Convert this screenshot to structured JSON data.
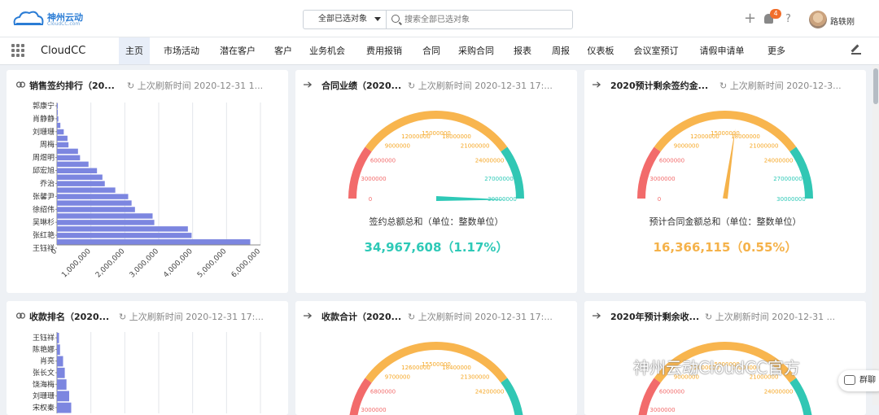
{
  "header": {
    "logo_text": "神州云动",
    "logo_sub": "CloudCC.com",
    "scope_label": "全部已选对象",
    "search_placeholder": "搜索全部已选对象",
    "notification_count": "4",
    "help": "?",
    "username": "路轶刚",
    "plus": "+"
  },
  "nav": {
    "app_name": "CloudCC",
    "tabs": [
      "主页",
      "市场活动",
      "潜在客户",
      "客户",
      "业务机会",
      "费用报销",
      "合同",
      "采购合同",
      "报表",
      "周报",
      "仪表板",
      "会议室预订",
      "请假申请单",
      "更多"
    ],
    "active": "主页"
  },
  "cards": {
    "c1": {
      "title": "销售签约排行（20...",
      "refresh": "上次刷新时间 2020-12-31 1..."
    },
    "c2": {
      "title": "合同业绩（2020...",
      "refresh": "上次刷新时间 2020-12-31 17:...",
      "label": "签约总额总和（单位：整数单位）",
      "value": "34,967,608（1.17%）",
      "value_color": "#2ec9b7"
    },
    "c3": {
      "title": "2020预计剩余签约金...",
      "refresh": "上次刷新时间 2020-12-3...",
      "label": "预计合同金额总和（单位：整数单位）",
      "value": "16,366,115（0.55%）",
      "value_color": "#f5b24a"
    },
    "c4": {
      "title": "收款排名（2020...",
      "refresh": "上次刷新时间 2020-12-31 17:..."
    },
    "c5": {
      "title": "收款合计（2020...",
      "refresh": "上次刷新时间 2020-12-31 17:..."
    },
    "c6": {
      "title": "2020年预计剩余收...",
      "refresh": "上次刷新时间 2020-12-31 ..."
    }
  },
  "chart_data": [
    {
      "type": "bar",
      "orientation": "horizontal",
      "title": "销售签约排行（20...",
      "categories": [
        "郭康宁",
        "",
        "肖静静",
        "",
        "刘珊珊",
        "",
        "周梅",
        "",
        "周煜明",
        "",
        "邱宏旭",
        "",
        "乔治",
        "",
        "张馨尹",
        "",
        "徐绍伟",
        "",
        "吴琳杉",
        "",
        "张红艳",
        "",
        "王钰祥"
      ],
      "values": [
        5000,
        10000,
        40000,
        100000,
        200000,
        310000,
        340000,
        620000,
        680000,
        930000,
        1180000,
        1340000,
        1410000,
        1720000,
        2100000,
        2200000,
        2300000,
        2820000,
        2870000,
        3860000,
        3970000,
        5700000
      ],
      "xlim": [
        0,
        6000000
      ],
      "xticks": [
        "0",
        "1,000,000",
        "2,000,000",
        "3,000,000",
        "4,000,000",
        "5,000,000",
        "6,000,000"
      ]
    },
    {
      "type": "gauge",
      "title": "合同业绩（2020...",
      "min": 0,
      "max": 30000000,
      "ticks": [
        "0",
        "3000000",
        "6000000",
        "9000000",
        "12000000",
        "15000000",
        "18000000",
        "21000000",
        "24000000",
        "27000000",
        "30000000"
      ],
      "value": 34967608,
      "percent": "1.17%",
      "segments": [
        {
          "to": 0.2,
          "color": "#f26b6b"
        },
        {
          "to": 0.8,
          "color": "#f8b54e"
        },
        {
          "to": 1,
          "color": "#31c7b4"
        }
      ]
    },
    {
      "type": "gauge",
      "title": "2020预计剩余签约金...",
      "min": 0,
      "max": 30000000,
      "ticks": [
        "0",
        "3000000",
        "6000000",
        "9000000",
        "12000000",
        "15000000",
        "18000000",
        "21000000",
        "24000000",
        "27000000",
        "30000000"
      ],
      "value": 16366115,
      "percent": "0.55%",
      "segments": [
        {
          "to": 0.2,
          "color": "#f26b6b"
        },
        {
          "to": 0.8,
          "color": "#f8b54e"
        },
        {
          "to": 1,
          "color": "#31c7b4"
        }
      ]
    },
    {
      "type": "bar",
      "orientation": "horizontal",
      "title": "收款排名（2020...",
      "categories": [
        "王钰祥",
        "陈艳娜",
        "肖亮",
        "张长文",
        "饶海梅",
        "刘珊珊",
        "宋权秦"
      ],
      "values": [
        60000,
        90000,
        180000,
        230000,
        280000,
        360000,
        420000
      ],
      "xlim": [
        0,
        6000000
      ]
    },
    {
      "type": "gauge",
      "title": "收款合计（2020...",
      "ticks": [
        "0",
        "3000000",
        "6800000",
        "9700000",
        "12600000",
        "15500000",
        "18400000",
        "21300000",
        "24200000"
      ]
    },
    {
      "type": "gauge",
      "title": "2020年预计剩余收...",
      "ticks": [
        "0",
        "3000000",
        "6000000",
        "9000000",
        "12000000",
        "15000000",
        "18000000",
        "21000000",
        "24000000"
      ]
    }
  ],
  "watermark": "神州云动CloudCC官方",
  "group_button": "群聊"
}
